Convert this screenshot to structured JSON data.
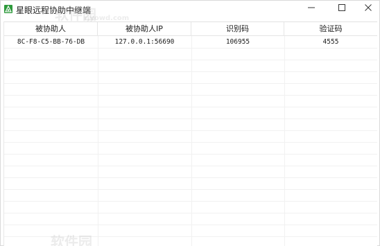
{
  "window": {
    "title": "星眼远程协助中继端"
  },
  "titlebar_controls": {
    "minimize_icon": "minimize-icon",
    "maximize_icon": "maximize-icon",
    "close_icon": "close-icon"
  },
  "table": {
    "columns": [
      "被协助人",
      "被协助人IP",
      "识别码",
      "验证码"
    ],
    "rows": [
      [
        "8C-F8-C5-BB-76-DB",
        "127.0.0.1:56690",
        "106955",
        "4555"
      ]
    ]
  },
  "watermark": {
    "text": "软件园",
    "url": "rjyowd.com"
  }
}
